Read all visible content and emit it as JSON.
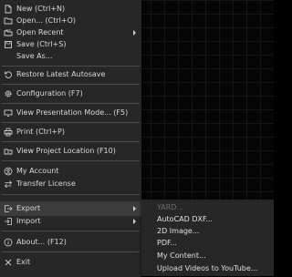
{
  "menu": {
    "items": [
      {
        "label": "New (Ctrl+N)",
        "icon": "new-file-icon"
      },
      {
        "label": "Open... (Ctrl+O)",
        "icon": "folder-open-icon"
      },
      {
        "label": "Open Recent",
        "icon": "open-recent-icon",
        "has_submenu": true
      },
      {
        "label": "Save (Ctrl+S)",
        "icon": "save-icon"
      },
      {
        "label": "Save As...",
        "icon": ""
      },
      {
        "label": "Restore Latest Autosave",
        "icon": "restore-icon"
      },
      {
        "label": "Configuration (F7)",
        "icon": "gear-icon"
      },
      {
        "label": "View Presentation Mode... (F5)",
        "icon": "presentation-icon"
      },
      {
        "label": "Print (Ctrl+P)",
        "icon": "print-icon"
      },
      {
        "label": "View Project Location (F10)",
        "icon": "location-icon"
      },
      {
        "label": "My Account",
        "icon": "user-icon"
      },
      {
        "label": "Transfer License",
        "icon": "transfer-icon"
      },
      {
        "label": "Export",
        "icon": "export-icon",
        "has_submenu": true,
        "active": true
      },
      {
        "label": "Import",
        "icon": "import-icon",
        "has_submenu": true
      },
      {
        "label": "About... (F12)",
        "icon": "info-icon"
      },
      {
        "label": "Exit",
        "icon": "close-icon"
      }
    ]
  },
  "export_submenu": {
    "items": [
      {
        "label": "YARD...",
        "disabled": true
      },
      {
        "label": "AutoCAD DXF..."
      },
      {
        "label": "2D Image..."
      },
      {
        "label": "PDF..."
      },
      {
        "label": "My Content..."
      },
      {
        "label": "Upload Videos to YouTube..."
      }
    ]
  },
  "colors": {
    "menu_bg": "#272727",
    "active_bg": "#3c3c3c",
    "text": "#d9d9d9",
    "disabled_text": "#6e6e6e",
    "canvas_bg": "#050505"
  }
}
